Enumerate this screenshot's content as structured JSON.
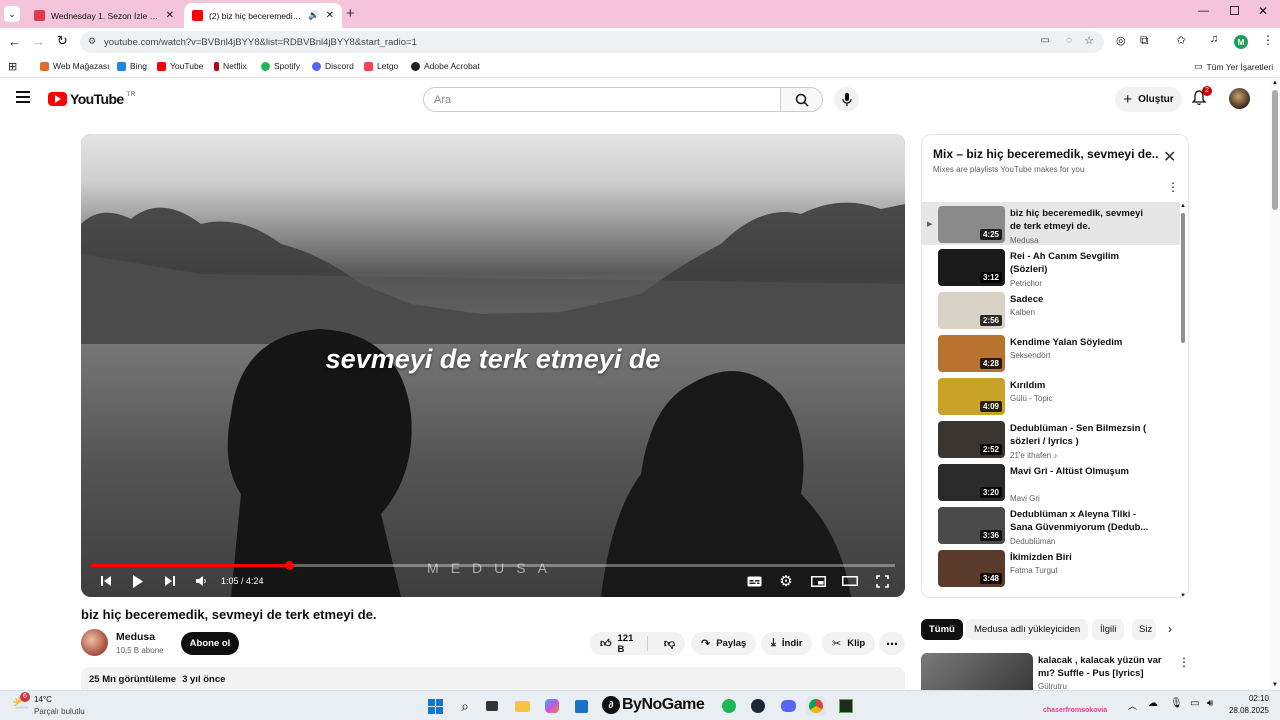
{
  "browser": {
    "tabs": [
      {
        "title": "Wednesday 1. Sezon İzle - Dizi",
        "active": false
      },
      {
        "title": "(2) biz hiç beceremedik, sev",
        "active": true
      }
    ],
    "new_tab": "+",
    "url": "youtube.com/watch?v=BVBnl4jBYY8&list=RDBVBnl4jBYY8&start_radio=1",
    "profile_initial": "M",
    "bookmarks": [
      "Web Mağazası",
      "Bing",
      "YouTube",
      "Netflix",
      "Spotify",
      "Discord",
      "Letgo",
      "Adobe Acrobat"
    ],
    "all_bookmarks": "Tüm Yer İşaretleri"
  },
  "youtube": {
    "logo": "YouTube",
    "region": "TR",
    "search_placeholder": "Ara",
    "create_label": "Oluştur",
    "notif_count": "2"
  },
  "player": {
    "subtitle": "sevmeyi de terk etmeyi de",
    "watermark": "MEDUSA",
    "time": "1:05 / 4:24",
    "progress": 0.246
  },
  "video": {
    "title": "biz hiç beceremedik, sevmeyi de terk etmeyi de.",
    "channel": "Medusa",
    "subscribers": "10,5 B abone",
    "subscribe": "Abone ol",
    "likes": "121 B",
    "share": "Paylaş",
    "download": "İndir",
    "clip": "Klip",
    "views": "25 Mn görüntüleme",
    "age": "3 yıl önce"
  },
  "mix": {
    "title": "Mix – biz hiç beceremedik, sevmeyi de...",
    "subtitle": "Mixes are playlists YouTube makes for you",
    "items": [
      {
        "title": "biz hiç beceremedik, sevmeyi de terk etmeyi de.",
        "channel": "Medusa",
        "duration": "4:25",
        "color": "#8a8a8a"
      },
      {
        "title": "Rei - Ah Canım Sevgilim (Sözleri)",
        "channel": "Petrichor",
        "duration": "3:12",
        "color": "#1a1a1a"
      },
      {
        "title": "Sadece",
        "channel": "Kalben",
        "duration": "2:56",
        "color": "#d8d2c6"
      },
      {
        "title": "Kendime Yalan Söyledim",
        "channel": "Seksendört",
        "duration": "4:28",
        "color": "#b8742e"
      },
      {
        "title": "Kırıldım",
        "channel": "Gülü - Topic",
        "duration": "4:09",
        "color": "#c9a227"
      },
      {
        "title": "Dedublüman - Sen Bilmezsin ( sözleri / lyrics )",
        "channel": "21'e ithafen ♪",
        "duration": "2:52",
        "color": "#3a3530"
      },
      {
        "title": "Mavi Gri - Altüst Olmuşum",
        "channel": "Mavi Gri",
        "duration": "3:20",
        "color": "#2a2a2a"
      },
      {
        "title": "Dedublüman x Aleyna Tilki - Sana Güvenmiyorum (Dedub...",
        "channel": "Dedublüman",
        "duration": "3:36",
        "color": "#4a4a4a"
      },
      {
        "title": "İkimizden Biri",
        "channel": "Fatma Turgut",
        "duration": "3:48",
        "color": "#5a3a2a"
      }
    ]
  },
  "chips": [
    "Tümü",
    "Medusa adlı yükleyiciden",
    "İlgili",
    "Siz"
  ],
  "recommendation": {
    "title": "kalacak , kalacak yüzün var mı? Suffle - Pus [lyrics]",
    "channel": "Gülrutru"
  },
  "taskbar": {
    "weather_temp": "14°C",
    "weather_desc": "Parçalı bulutlu",
    "weather_badge": "6",
    "time": "02:10",
    "date": "28.08.2025",
    "overlay_text": "ByNoGame",
    "overlay_user": "chaserfromsokovia"
  }
}
